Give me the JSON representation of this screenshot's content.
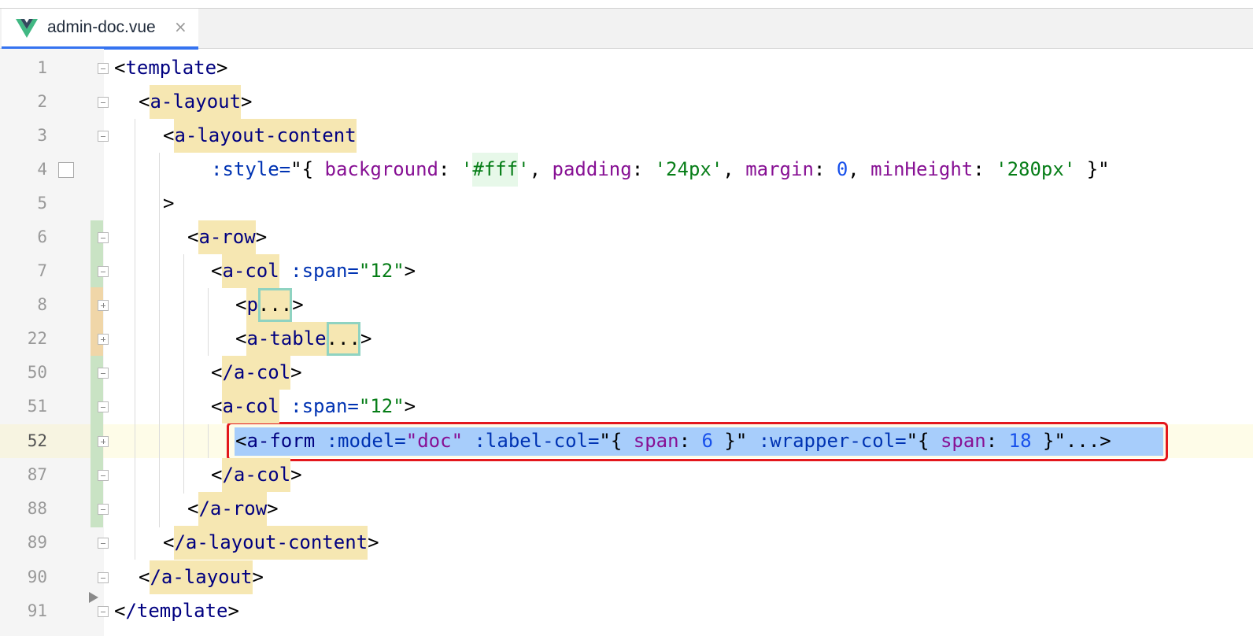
{
  "tab": {
    "filename": "admin-doc.vue",
    "close_glyph": "×",
    "icon": "vue-icon"
  },
  "colors": {
    "tab_underline": "#3573f0",
    "selection": "#a7cdfb",
    "annotation_box": "#e3171c",
    "tag": "#000080",
    "attribute": "#0033b3",
    "string": "#067d17",
    "number": "#1750eb",
    "key": "#871094",
    "match_highlight": "#f6e7b2"
  },
  "lines": [
    {
      "no": "1"
    },
    {
      "no": "2"
    },
    {
      "no": "3"
    },
    {
      "no": "4"
    },
    {
      "no": "5"
    },
    {
      "no": "6"
    },
    {
      "no": "7"
    },
    {
      "no": "8"
    },
    {
      "no": "22"
    },
    {
      "no": "50"
    },
    {
      "no": "51"
    },
    {
      "no": "52"
    },
    {
      "no": "87"
    },
    {
      "no": "88"
    },
    {
      "no": "89"
    },
    {
      "no": "90"
    },
    {
      "no": "91"
    }
  ],
  "code": {
    "l1_tag": "template",
    "l2_tag": "a-layout",
    "l3_tag": "a-layout-content",
    "l4_attr": ":style=",
    "l4_q1": "\"{ ",
    "l4_k1": "background",
    "l4_c1": ": ",
    "l4_v1a": "'",
    "l4_v1b": "#fff",
    "l4_v1c": "'",
    "l4_sep1": ", ",
    "l4_k2": "padding",
    "l4_c2": ": ",
    "l4_v2": "'24px'",
    "l4_sep2": ", ",
    "l4_k3": "margin",
    "l4_c3": ": ",
    "l4_v3": "0",
    "l4_sep3": ", ",
    "l4_k4": "minHeight",
    "l4_c4": ": ",
    "l4_v4": "'280px'",
    "l4_q2": " }\"",
    "l5_text": ">",
    "l6_tag": "a-row",
    "l7_tag": "a-col",
    "l7_attr": ":span=",
    "l7_val": "\"12\"",
    "l8_tag": "p",
    "l8_fold": "...",
    "l22_tag": "a-table",
    "l22_fold": "...",
    "l50_tag": "/a-col",
    "l51_tag": "a-col",
    "l51_attr": ":span=",
    "l51_val": "\"12\"",
    "l52_tag": "a-form",
    "l52_a1": ":model=",
    "l52_v1": "\"doc\"",
    "l52_a2": ":label-col=",
    "l52_q1": "\"{ ",
    "l52_k1": "span",
    "l52_c1": ": ",
    "l52_n1": "6",
    "l52_q2": " }\"",
    "l52_a3": ":wrapper-col=",
    "l52_q3": "\"{ ",
    "l52_k2": "span",
    "l52_c2": ": ",
    "l52_n2": "18",
    "l52_q4": " }\"",
    "l52_fold": "...",
    "l87_tag": "/a-col",
    "l88_tag": "/a-row",
    "l89_tag": "/a-layout-content",
    "l90_tag": "/a-layout",
    "l91_tag": "/template"
  }
}
